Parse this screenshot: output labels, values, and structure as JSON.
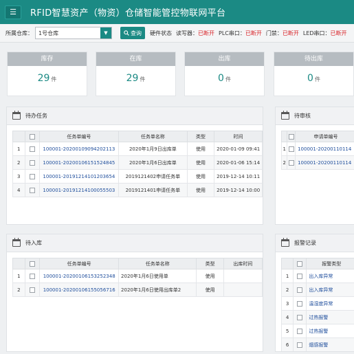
{
  "app": {
    "title": "RFID智慧资产（物资）仓储智能管控物联网平台",
    "menu_icon": "menu-icon"
  },
  "toolbar": {
    "warehouse_label": "所属仓库：",
    "warehouse_value": "1号仓库",
    "query_label": "查询",
    "hw_label": "硬件状态",
    "hw_items": [
      {
        "name": "读写器：",
        "status": "已断开"
      },
      {
        "name": "PLC串口：",
        "status": "已断开"
      },
      {
        "name": "门禁：",
        "status": "已断开"
      },
      {
        "name": "LED串口：",
        "status": "已断开"
      }
    ],
    "status_color": "#d9262b"
  },
  "stats": [
    {
      "label": "库存",
      "value": "29",
      "unit": "件"
    },
    {
      "label": "在库",
      "value": "29",
      "unit": "件"
    },
    {
      "label": "出库",
      "value": "0",
      "unit": "件"
    },
    {
      "label": "待出库",
      "value": "0",
      "unit": "件"
    }
  ],
  "pending_tasks": {
    "title": "待办任务",
    "columns": [
      "",
      "",
      "任务单编号",
      "任务单名称",
      "类型",
      "时间"
    ],
    "rows": [
      {
        "no": "1",
        "id": "100001-20200109094202113",
        "name": "2020年1月9日出库单",
        "type": "使用",
        "time": "2020-01-09 09:41"
      },
      {
        "no": "2",
        "id": "100001-20200106151524845",
        "name": "2020年1月6日出库单",
        "type": "使用",
        "time": "2020-01-06 15:14"
      },
      {
        "no": "3",
        "id": "100001-20191214101203654",
        "name": "2019121402申请任务单",
        "type": "使用",
        "time": "2019-12-14 10:11"
      },
      {
        "no": "4",
        "id": "100001-20191214100055503",
        "name": "2019121401申请任务单",
        "type": "使用",
        "time": "2019-12-14 10:00"
      }
    ]
  },
  "pending_review": {
    "title": "待审核",
    "columns": [
      "",
      "",
      "申请单编号"
    ],
    "rows": [
      {
        "no": "1",
        "id": "100001-20200110114"
      },
      {
        "no": "2",
        "id": "100001-20200110114"
      }
    ]
  },
  "pending_inbound": {
    "title": "待入库",
    "columns": [
      "",
      "",
      "任务单编号",
      "任务单名称",
      "类型",
      "出库时间"
    ],
    "rows": [
      {
        "no": "1",
        "id": "100001-20200106153252348",
        "name": "2020年1月6日使用单",
        "type": "使用",
        "time": ""
      },
      {
        "no": "2",
        "id": "100001-20200106155056716",
        "name": "2020年1月6日使用出库单2",
        "type": "使用",
        "time": ""
      }
    ]
  },
  "alarm_records": {
    "title": "报警记录",
    "columns": [
      "",
      "",
      "报警类型"
    ],
    "rows": [
      {
        "no": "1",
        "type": "出入库异常"
      },
      {
        "no": "2",
        "type": "出入库异常"
      },
      {
        "no": "3",
        "type": "温湿度异常"
      },
      {
        "no": "4",
        "type": "过热报警"
      },
      {
        "no": "5",
        "type": "过热报警"
      },
      {
        "no": "6",
        "type": "烟感报警"
      }
    ]
  }
}
